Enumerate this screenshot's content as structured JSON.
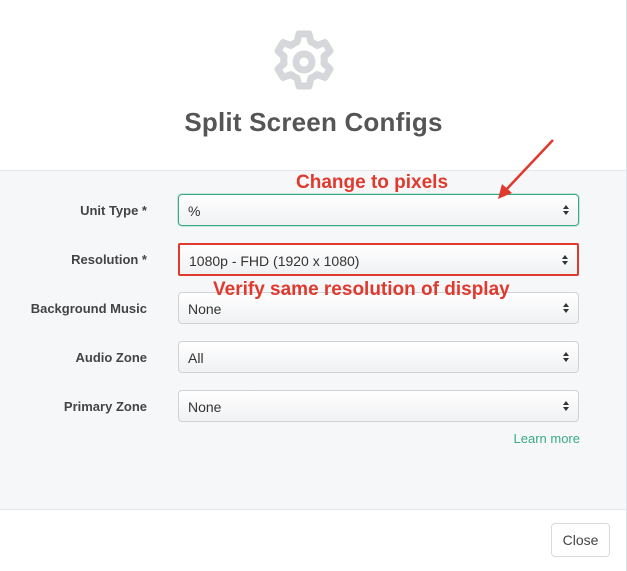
{
  "modal": {
    "title": "Split Screen Configs",
    "icon": "gear-icon"
  },
  "form": {
    "unit_type": {
      "label": "Unit Type *",
      "value": "%"
    },
    "resolution": {
      "label": "Resolution *",
      "value": "1080p - FHD (1920 x 1080)"
    },
    "background_music": {
      "label": "Background Music",
      "value": "None"
    },
    "audio_zone": {
      "label": "Audio Zone",
      "value": "All"
    },
    "primary_zone": {
      "label": "Primary Zone",
      "value": "None"
    },
    "learn_more": "Learn more"
  },
  "annotations": {
    "unit_type_note": "Change to pixels",
    "resolution_note": "Verify same resolution of display",
    "color": "#e03a2f"
  },
  "footer": {
    "close_label": "Close"
  },
  "colors": {
    "accent": "#3aaa84",
    "annotation": "#e03a2f"
  }
}
